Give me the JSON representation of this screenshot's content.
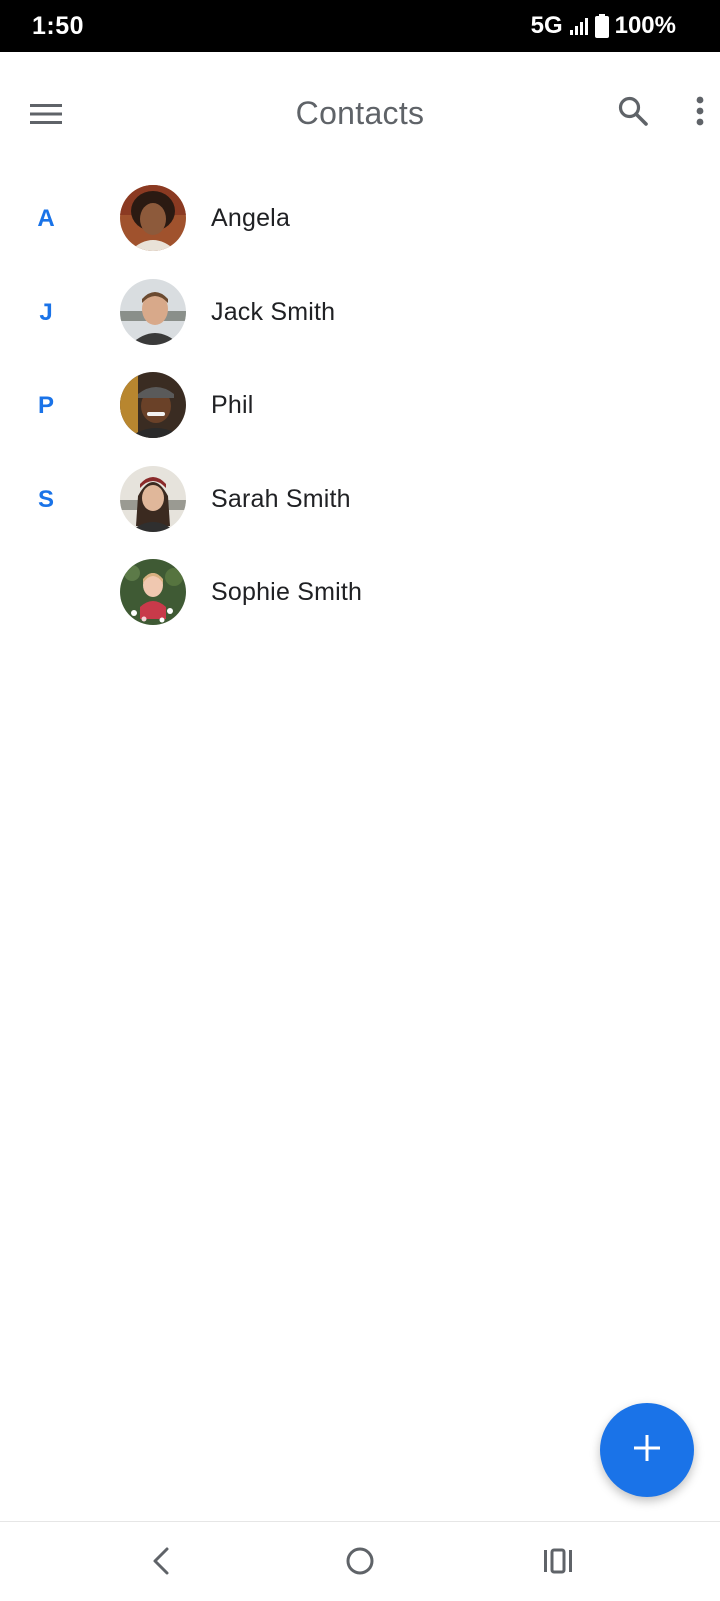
{
  "status_bar": {
    "time": "1:50",
    "network": "5G",
    "battery": "100%"
  },
  "app_bar": {
    "title": "Contacts",
    "menu_icon": "hamburger-menu-icon",
    "search_icon": "search-icon",
    "more_icon": "more-vert-icon"
  },
  "contacts": [
    {
      "letter": "A",
      "name": "Angela"
    },
    {
      "letter": "J",
      "name": "Jack Smith"
    },
    {
      "letter": "P",
      "name": "Phil"
    },
    {
      "letter": "S",
      "name": "Sarah Smith"
    },
    {
      "letter": "",
      "name": "Sophie Smith"
    }
  ],
  "fab": {
    "icon": "add-icon"
  },
  "nav_bar": {
    "back_icon": "back-icon",
    "home_icon": "home-icon",
    "recents_icon": "recents-icon"
  },
  "colors": {
    "accent": "#1a73e8",
    "title": "#5f6368",
    "text": "#202124",
    "status_bar_bg": "#000000"
  }
}
